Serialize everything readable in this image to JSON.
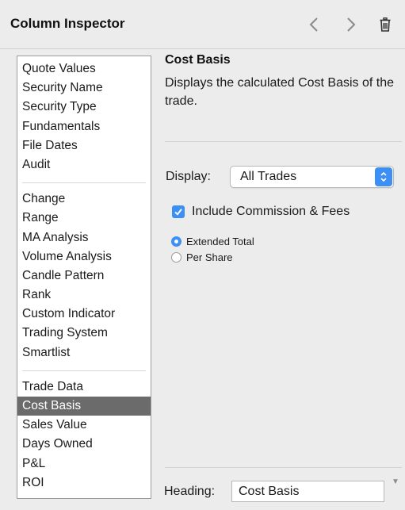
{
  "window": {
    "title": "Column Inspector"
  },
  "icons": {
    "prev": "chevron-left-icon",
    "next": "chevron-right-icon",
    "trash": "trash-icon"
  },
  "colors": {
    "accent": "#3b8ff5",
    "selection": "#6b6b6b",
    "background": "#ececec"
  },
  "sidebar": {
    "groups": [
      [
        "Quote Values",
        "Security Name",
        "Security Type",
        "Fundamentals",
        "File Dates",
        "Audit"
      ],
      [
        "Change",
        "Range",
        "MA Analysis",
        "Volume Analysis",
        "Candle Pattern",
        "Rank",
        "Custom Indicator",
        "Trading System",
        "Smartlist"
      ],
      [
        "Trade Data",
        "Cost Basis",
        "Sales Value",
        "Days Owned",
        "P&L",
        "ROI"
      ]
    ],
    "selected": "Cost Basis"
  },
  "detail": {
    "title": "Cost Basis",
    "description": "Displays the calculated Cost Basis of the trade.",
    "display_label": "Display:",
    "display_value": "All Trades",
    "include_fees_label": "Include Commission & Fees",
    "include_fees_checked": true,
    "radio_options": [
      "Extended Total",
      "Per Share"
    ],
    "radio_selected": "Extended Total",
    "heading_label": "Heading:",
    "heading_value": "Cost Basis"
  }
}
